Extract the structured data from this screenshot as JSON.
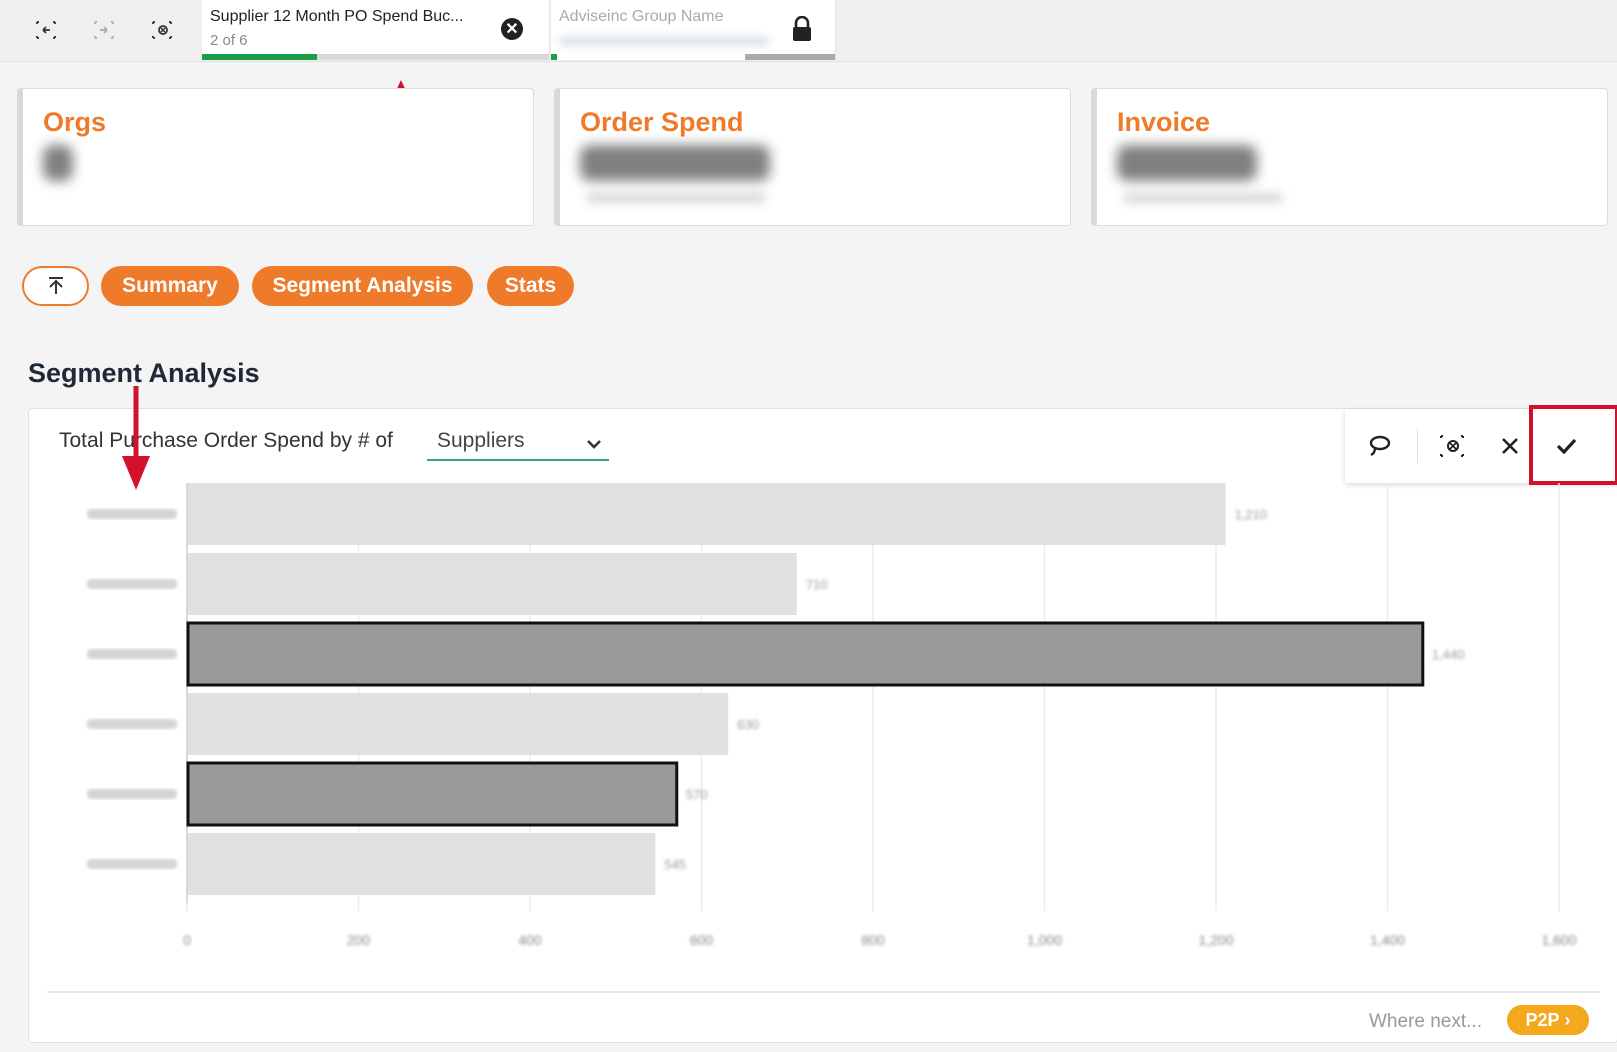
{
  "tabs": [
    {
      "title": "Supplier 12 Month PO Spend Buc...",
      "subtitle": "2 of 6",
      "progress": 0.33
    },
    {
      "title": "Adviseinc Group Name",
      "subtitle": "",
      "progress": 0.02
    }
  ],
  "kpis": [
    {
      "title": "Orgs"
    },
    {
      "title": "Order Spend"
    },
    {
      "title": "Invoice"
    }
  ],
  "nav": {
    "up_icon": "arrow-up-to-top-icon",
    "pills": [
      "Summary",
      "Segment Analysis",
      "Stats"
    ]
  },
  "section_title": "Segment Analysis",
  "chart_card": {
    "label": "Total Purchase Order Spend by # of",
    "dropdown_value": "Suppliers"
  },
  "chart_data": {
    "type": "bar",
    "orientation": "horizontal",
    "categories": [
      "",
      "",
      "",
      "",
      "",
      ""
    ],
    "values": [
      1210,
      710,
      1440,
      630,
      570,
      545
    ],
    "highlighted": [
      false,
      false,
      true,
      false,
      true,
      false
    ],
    "xlim": [
      0,
      1600
    ],
    "xticks": [
      0,
      200,
      400,
      600,
      800,
      1000,
      1200,
      1400,
      1600
    ],
    "grid": true
  },
  "footer": {
    "where_next": "Where next...",
    "p2p": "P2P"
  },
  "colors": {
    "accent": "#ef7a2a",
    "progress": "#1a9e47",
    "highlight_box": "#d3112c",
    "bar": "#e0e0e0",
    "bar_selected": "#9a9a9a"
  }
}
